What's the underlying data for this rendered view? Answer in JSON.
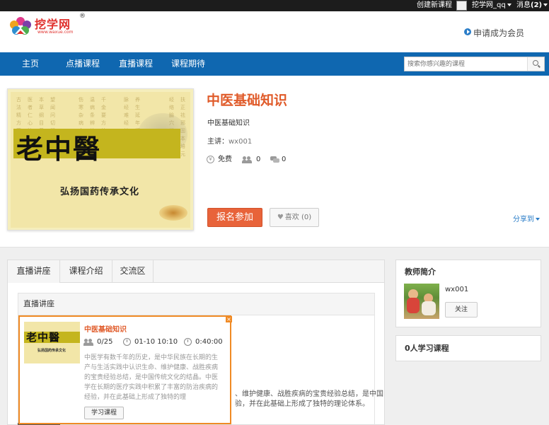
{
  "topbar": {
    "create_course": "创建新课程",
    "username": "挖学网_qq",
    "messages": "消息",
    "message_count": "(2)"
  },
  "header": {
    "logo_text": "挖学网",
    "logo_reg": "®",
    "logo_url": "www.waxue.com",
    "member_link": "申请成为会员"
  },
  "nav": {
    "items": [
      "主页",
      "点播课程",
      "直播课程",
      "课程期待"
    ],
    "search_placeholder": "搜索你感兴趣的课程"
  },
  "course": {
    "title": "中医基础知识",
    "subtitle": "中医基础知识",
    "lecturer_label": "主讲：",
    "lecturer": "wx001",
    "price": "免费",
    "students": "0",
    "comments": "0",
    "join_button": "报名参加",
    "like_label": "喜欢",
    "like_count": "(0)",
    "share_label": "分享到",
    "cover_big_text": "老中醫",
    "cover_sub_text": "弘扬国药传承文化"
  },
  "tabs": [
    "直播讲座",
    "课程介绍",
    "交流区"
  ],
  "section": {
    "heading": "直播讲座",
    "body_line1": "、维护健康、战胜疾病的宝贵经验总结，是中国",
    "body_line2": "验，并在此基础上形成了独特的理论体系。"
  },
  "popup": {
    "title": "中医基础知识",
    "enrolled": "0/25",
    "date": "01-10 10:10",
    "duration": "0:40:00",
    "description": [
      "中医学有数千年的历史，是中华民族在长期的生",
      "产与生活实践中认识生命、维护健康、战胜疾病",
      "的宝贵经验总结，是中国传统文化的结晶。中医",
      "学在长期的医疗实践中积累了丰富的防治疾病的",
      "经验，并在此基础上形成了独特的理"
    ],
    "button": "学习课程",
    "close": "×"
  },
  "sidebar": {
    "teacher_title": "教师简介",
    "teacher_name": "wx001",
    "follow_button": "关注",
    "learners_title": "0人学习课程"
  },
  "colors": {
    "nav_bg": "#0f67b0",
    "accent_orange": "#e8633a",
    "title_orange": "#e05b2a",
    "popup_border": "#f08a24",
    "link_blue": "#2a7dc8"
  }
}
